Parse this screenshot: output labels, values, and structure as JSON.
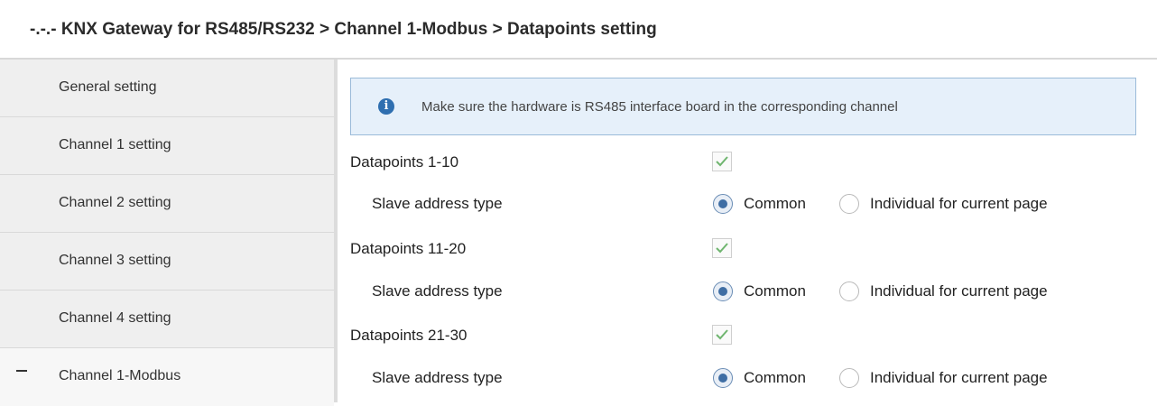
{
  "title": "-.-.- KNX Gateway for RS485/RS232 > Channel 1-Modbus > Datapoints setting",
  "sidebar": {
    "items": [
      {
        "label": "General setting"
      },
      {
        "label": "Channel 1 setting"
      },
      {
        "label": "Channel 2 setting"
      },
      {
        "label": "Channel 3 setting"
      },
      {
        "label": "Channel 4 setting"
      },
      {
        "label": "Channel 1-Modbus",
        "expanded": true
      }
    ]
  },
  "info": {
    "icon": "info-icon",
    "message": "Make sure the hardware is RS485 interface board in the corresponding channel"
  },
  "groups": [
    {
      "label": "Datapoints 1-10",
      "checked": true,
      "sub_label": "Slave address type",
      "options": [
        "Common",
        "Individual for current page"
      ],
      "selected": "Common"
    },
    {
      "label": "Datapoints 11-20",
      "checked": true,
      "sub_label": "Slave address type",
      "options": [
        "Common",
        "Individual for current page"
      ],
      "selected": "Common"
    },
    {
      "label": "Datapoints 21-30",
      "checked": true,
      "sub_label": "Slave address type",
      "options": [
        "Common",
        "Individual for current page"
      ],
      "selected": "Common"
    }
  ],
  "colors": {
    "accent": "#2f6fb0",
    "check": "#6fb56f",
    "info_bg": "#e6f0fa"
  }
}
